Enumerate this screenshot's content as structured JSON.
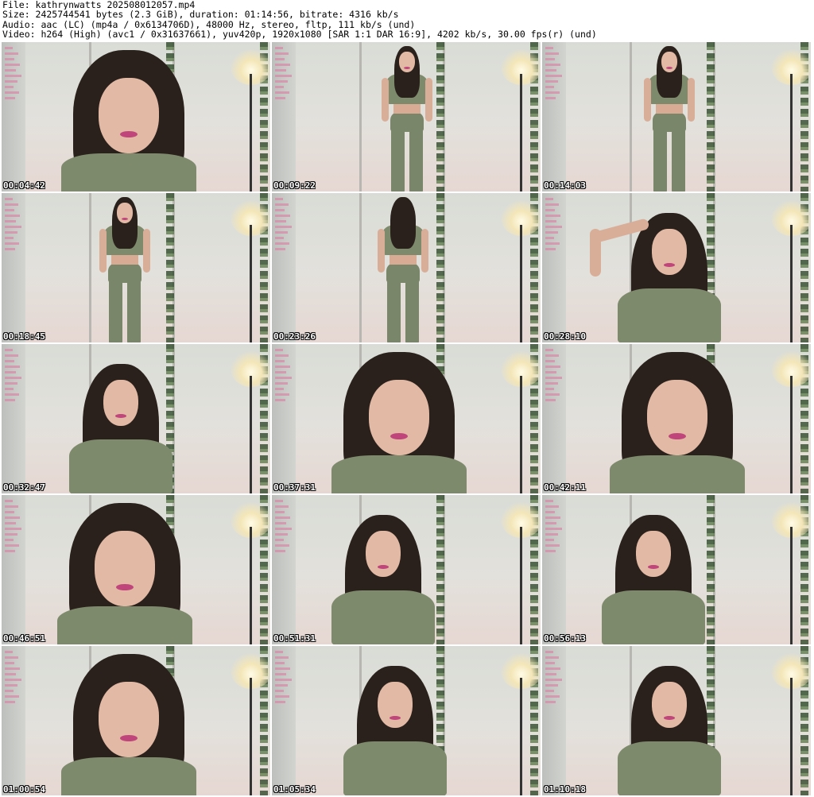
{
  "header": {
    "file_line": "File: kathrynwatts_202508012057.mp4",
    "size_line": "Size: 2425744541 bytes (2.3 GiB), duration: 01:14:56, bitrate: 4316 kb/s",
    "audio_line": "Audio: aac (LC) (mp4a / 0x6134706D), 48000 Hz, stereo, fltp, 111 kb/s (und)",
    "video_line": "Video: h264 (High) (avc1 / 0x31637661), yuv420p, 1920x1080 [SAR 1:1 DAR 16:9], 4202 kb/s, 30.00 fps(r) (und)"
  },
  "colors": {
    "background": "#ffffff",
    "timestamp_text": "#ffffff",
    "outfit": "#7d8a6c",
    "hair": "#2b211c"
  },
  "thumbnails": [
    {
      "timestamp": "00:04:42",
      "shot": "close-up"
    },
    {
      "timestamp": "00:09:22",
      "shot": "full-body"
    },
    {
      "timestamp": "00:14:03",
      "shot": "full-body"
    },
    {
      "timestamp": "00:18:45",
      "shot": "full-body"
    },
    {
      "timestamp": "00:23:26",
      "shot": "full-body-back"
    },
    {
      "timestamp": "00:28:10",
      "shot": "medium-arm-raised"
    },
    {
      "timestamp": "00:32:47",
      "shot": "medium"
    },
    {
      "timestamp": "00:37:31",
      "shot": "close-up"
    },
    {
      "timestamp": "00:42:11",
      "shot": "close-up"
    },
    {
      "timestamp": "00:46:51",
      "shot": "close-up"
    },
    {
      "timestamp": "00:51:31",
      "shot": "medium"
    },
    {
      "timestamp": "00:56:13",
      "shot": "medium"
    },
    {
      "timestamp": "01:00:54",
      "shot": "close-up"
    },
    {
      "timestamp": "01:05:34",
      "shot": "medium"
    },
    {
      "timestamp": "01:10:18",
      "shot": "medium"
    }
  ]
}
